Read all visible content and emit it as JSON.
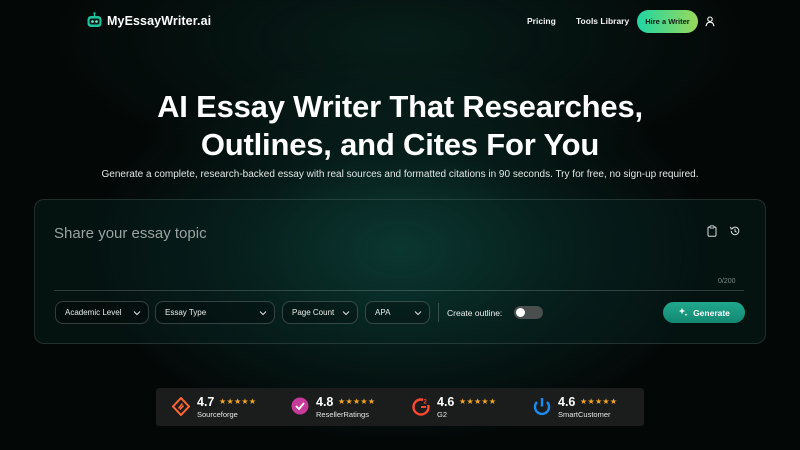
{
  "header": {
    "brand": "MyEssayWriter.ai",
    "nav_pricing": "Pricing",
    "nav_tools": "Tools Library",
    "hire_label": "Hire a Writer"
  },
  "hero": {
    "title_line1": "AI Essay Writer That Researches,",
    "title_line2": "Outlines, and Cites For You",
    "subtitle": "Generate a complete, research-backed essay with real sources and formatted citations in 90 seconds. Try for free, no sign-up required."
  },
  "form": {
    "topic_placeholder": "Share your essay topic",
    "topic_value": "",
    "char_counter": "0/200",
    "academic_level": "Academic Level",
    "essay_type": "Essay Type",
    "page_count": "Page Count",
    "citation_style": "APA",
    "outline_label": "Create outline:",
    "outline_enabled": false,
    "generate_label": "Generate"
  },
  "ratings": [
    {
      "score": "4.7",
      "stars": "★★★★★",
      "source": "Sourceforge",
      "icon": "sourceforge-icon",
      "color": "#ff6633"
    },
    {
      "score": "4.8",
      "stars": "★★★★★",
      "source": "ResellerRatings",
      "icon": "resellerratings-icon",
      "color": "#c63a9a"
    },
    {
      "score": "4.6",
      "stars": "★★★★★",
      "source": "G2",
      "icon": "g2-icon",
      "color": "#ff492c"
    },
    {
      "score": "4.6",
      "stars": "★★★★★",
      "source": "SmartCustomer",
      "icon": "smartcustomer-icon",
      "color": "#1a8cf0"
    }
  ],
  "colors": {
    "accent": "#1fd6a3",
    "generate": "#1a9a80",
    "star": "#f6a623"
  }
}
